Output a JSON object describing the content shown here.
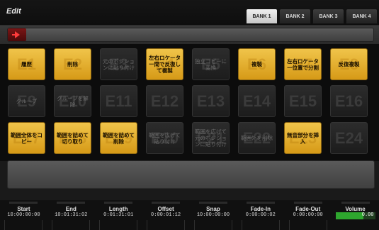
{
  "window": {
    "title": "Edit"
  },
  "banks": [
    {
      "label": "BANK 1",
      "active": true
    },
    {
      "label": "BANK 2",
      "active": false
    },
    {
      "label": "BANK 3",
      "active": false
    },
    {
      "label": "BANK 4",
      "active": false
    }
  ],
  "toolbar": {
    "toggle_icon": "red-arrow-icon",
    "accent": "#ff3b3b"
  },
  "grid": {
    "rows": [
      [
        {
          "label": "履歴",
          "bg": "E1",
          "on": true
        },
        {
          "label": "削除",
          "bg": "E2",
          "on": true
        },
        {
          "label": "元のポジションに貼り付け",
          "bg": "E3",
          "on": false
        },
        {
          "label": "左右ロケーター間で反復して複製",
          "bg": "E4",
          "on": true
        },
        {
          "label": "独立コピーに変換",
          "bg": "E5",
          "on": false
        },
        {
          "label": "複製",
          "bg": "E6",
          "on": true
        },
        {
          "label": "左右ロケーター位置で分割",
          "bg": "E7",
          "on": true
        },
        {
          "label": "反復複製",
          "bg": "E8",
          "on": true
        }
      ],
      [
        {
          "label": "グループ",
          "bg": "E9",
          "on": false
        },
        {
          "label": "グループを解除",
          "bg": "E10",
          "on": false
        },
        {
          "label": "",
          "bg": "E11",
          "on": false
        },
        {
          "label": "",
          "bg": "E12",
          "on": false
        },
        {
          "label": "",
          "bg": "E13",
          "on": false
        },
        {
          "label": "",
          "bg": "E14",
          "on": false
        },
        {
          "label": "",
          "bg": "E15",
          "on": false
        },
        {
          "label": "",
          "bg": "E16",
          "on": false
        }
      ],
      [
        {
          "label": "範囲全体をコピー",
          "bg": "E17",
          "on": true
        },
        {
          "label": "範囲を詰めて切り取り",
          "bg": "E18",
          "on": true
        },
        {
          "label": "範囲を詰めて削除",
          "bg": "E19",
          "on": true
        },
        {
          "label": "範囲を広げて貼り付け",
          "bg": "E20",
          "on": false
        },
        {
          "label": "範囲を広げて元のポジションに貼り付け",
          "bg": "E21",
          "on": false
        },
        {
          "label": "範囲外を削除",
          "bg": "E22",
          "on": false
        },
        {
          "label": "無音部分を挿入",
          "bg": "E23",
          "on": true
        },
        {
          "label": "",
          "bg": "E24",
          "on": false
        }
      ]
    ]
  },
  "status": [
    {
      "label": "Start",
      "value": "10:00:00:00"
    },
    {
      "label": "End",
      "value": "10:01:31:02"
    },
    {
      "label": "Length",
      "value": "0:01:31:01"
    },
    {
      "label": "Offset",
      "value": "0:00:01:12"
    },
    {
      "label": "Snap",
      "value": "10:00:00:00"
    },
    {
      "label": "Fade-In",
      "value": "0:00:00:02"
    },
    {
      "label": "Fade-Out",
      "value": "0:00:00:00"
    }
  ],
  "volume": {
    "label": "Volume",
    "value": "0.00",
    "level": 0.7
  },
  "colors": {
    "button_on": "#e8b635",
    "volume_fill": "#2ea62e"
  }
}
